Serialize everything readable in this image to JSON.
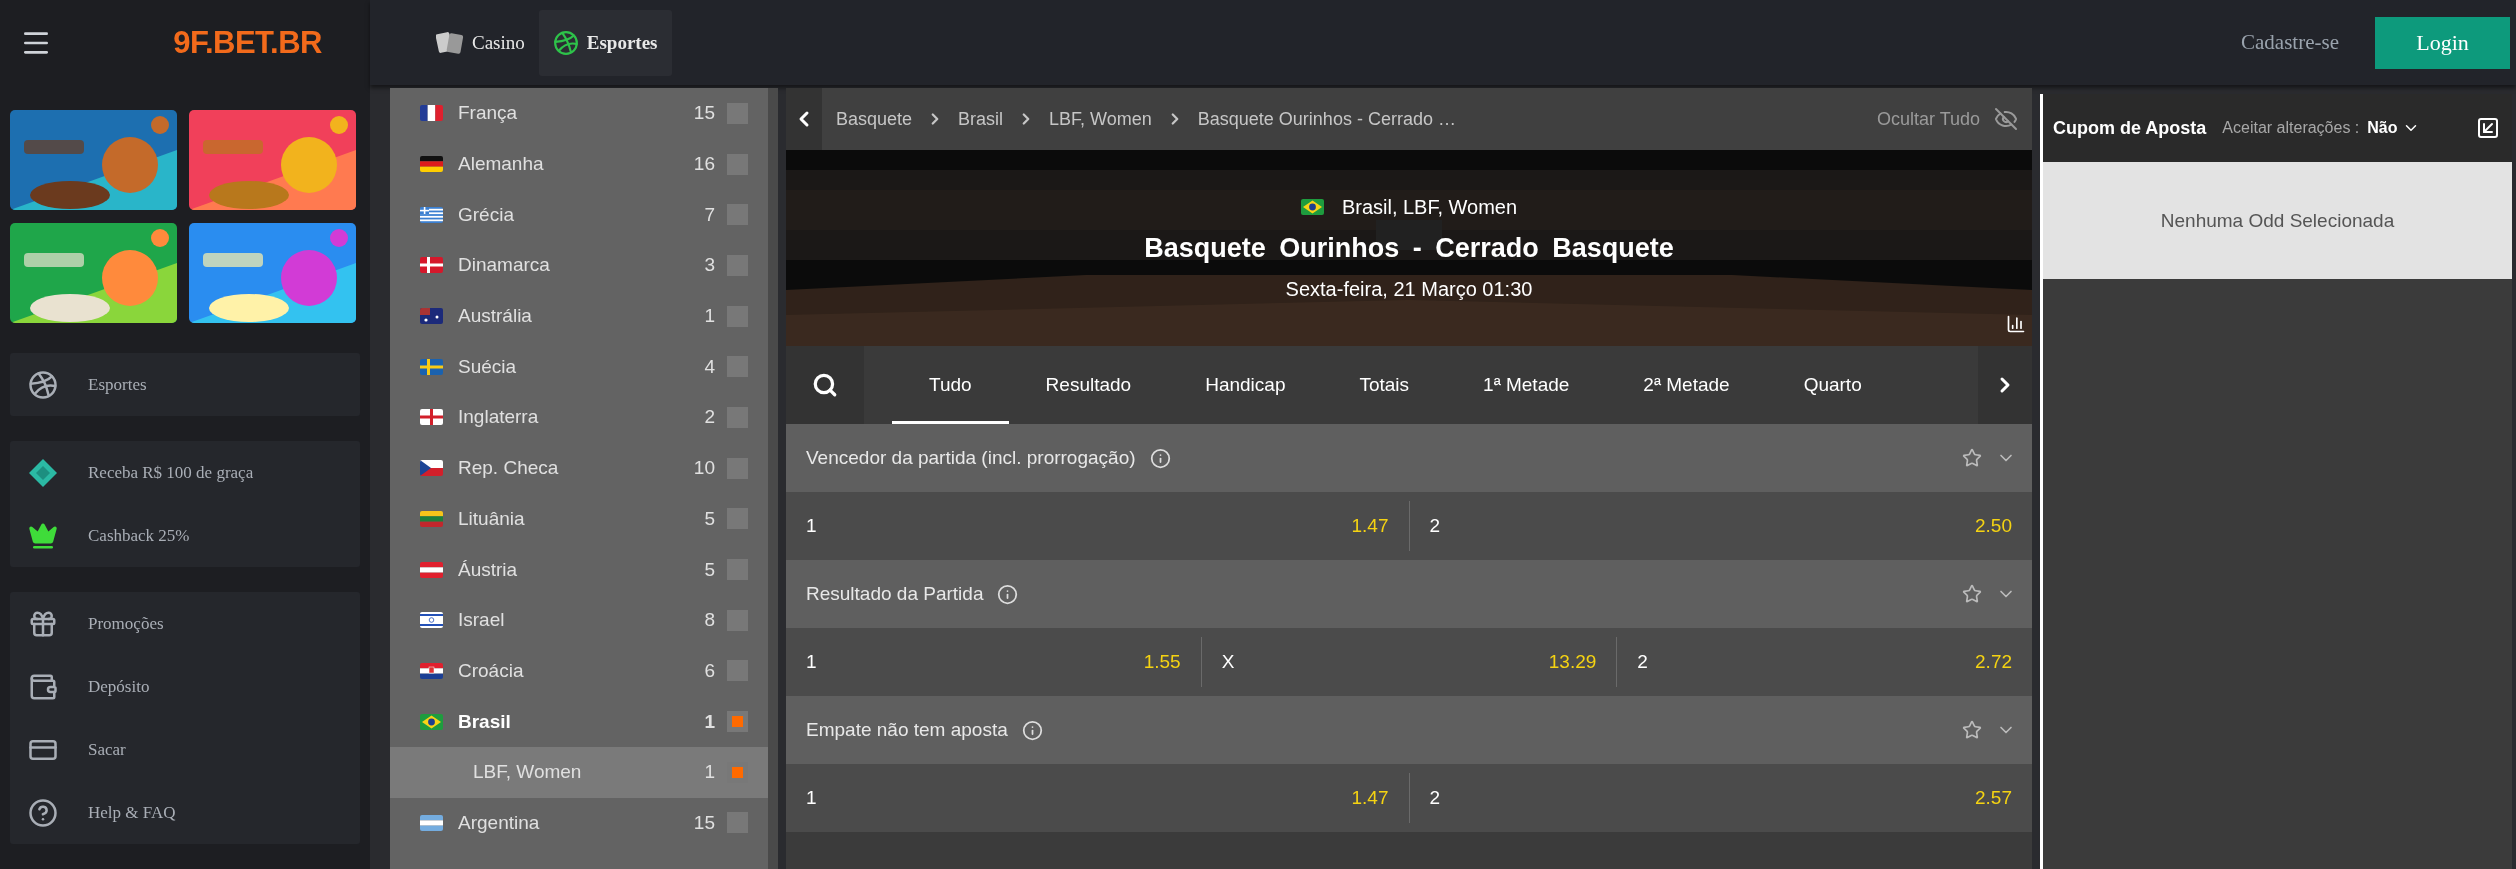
{
  "header": {
    "logo": "9F.BET.BR",
    "nav": [
      {
        "label": "Casino",
        "selected": false
      },
      {
        "label": "Esportes",
        "selected": true
      }
    ],
    "register": "Cadastre-se",
    "login": "Login"
  },
  "sidebar": {
    "groups": [
      {
        "items": [
          {
            "label": "Esportes"
          }
        ]
      },
      {
        "items": [
          {
            "label": "Receba R$ 100 de graça"
          },
          {
            "label": "Cashback 25%"
          }
        ]
      },
      {
        "items": [
          {
            "label": "Promoções"
          },
          {
            "label": "Depósito"
          },
          {
            "label": "Sacar"
          },
          {
            "label": "Help & FAQ"
          }
        ]
      }
    ]
  },
  "countries": [
    {
      "name": "França",
      "count": "15",
      "checked": false
    },
    {
      "name": "Alemanha",
      "count": "16",
      "checked": false
    },
    {
      "name": "Grécia",
      "count": "7",
      "checked": false
    },
    {
      "name": "Dinamarca",
      "count": "3",
      "checked": false
    },
    {
      "name": "Austrália",
      "count": "1",
      "checked": false
    },
    {
      "name": "Suécia",
      "count": "4",
      "checked": false
    },
    {
      "name": "Inglaterra",
      "count": "2",
      "checked": false
    },
    {
      "name": "Rep. Checa",
      "count": "10",
      "checked": false
    },
    {
      "name": "Lituânia",
      "count": "5",
      "checked": false
    },
    {
      "name": "Áustria",
      "count": "5",
      "checked": false
    },
    {
      "name": "Israel",
      "count": "8",
      "checked": false
    },
    {
      "name": "Croácia",
      "count": "6",
      "checked": false
    },
    {
      "name": "Brasil",
      "count": "1",
      "checked": true,
      "children": [
        {
          "name": "LBF, Women",
          "count": "1",
          "checked": true,
          "selected": true
        }
      ]
    },
    {
      "name": "Argentina",
      "count": "15",
      "checked": false
    }
  ],
  "event": {
    "breadcrumb": [
      "Basquete",
      "Brasil",
      "LBF, Women",
      "Basquete Ourinhos - Cerrado …"
    ],
    "hide_all": "Ocultar Tudo",
    "league": "Brasil, LBF, Women",
    "title": "Basquete Ourinhos - Cerrado Basquete",
    "date": "Sexta-feira, 21 Março 01:30"
  },
  "tabs": [
    {
      "label": "Tudo",
      "selected": true
    },
    {
      "label": "Resultado",
      "selected": false
    },
    {
      "label": "Handicap",
      "selected": false
    },
    {
      "label": "Totais",
      "selected": false
    },
    {
      "label": "1ª Metade",
      "selected": false
    },
    {
      "label": "2ª Metade",
      "selected": false
    },
    {
      "label": "Quarto",
      "selected": false
    }
  ],
  "markets": [
    {
      "title": "Vencedor da partida (incl. prorrogação)",
      "outcomes": [
        {
          "label": "1",
          "odds": "1.47"
        },
        {
          "label": "2",
          "odds": "2.50"
        }
      ]
    },
    {
      "title": "Resultado da Partida",
      "outcomes": [
        {
          "label": "1",
          "odds": "1.55"
        },
        {
          "label": "X",
          "odds": "13.29"
        },
        {
          "label": "2",
          "odds": "2.72"
        }
      ]
    },
    {
      "title": "Empate não tem aposta",
      "outcomes": [
        {
          "label": "1",
          "odds": "1.47"
        },
        {
          "label": "2",
          "odds": "2.57"
        }
      ]
    }
  ],
  "coupon": {
    "title": "Cupom de Aposta",
    "accept_label": "Aceitar alterações :",
    "accept_value": "Não",
    "empty": "Nenhuma Odd Selecionada"
  }
}
